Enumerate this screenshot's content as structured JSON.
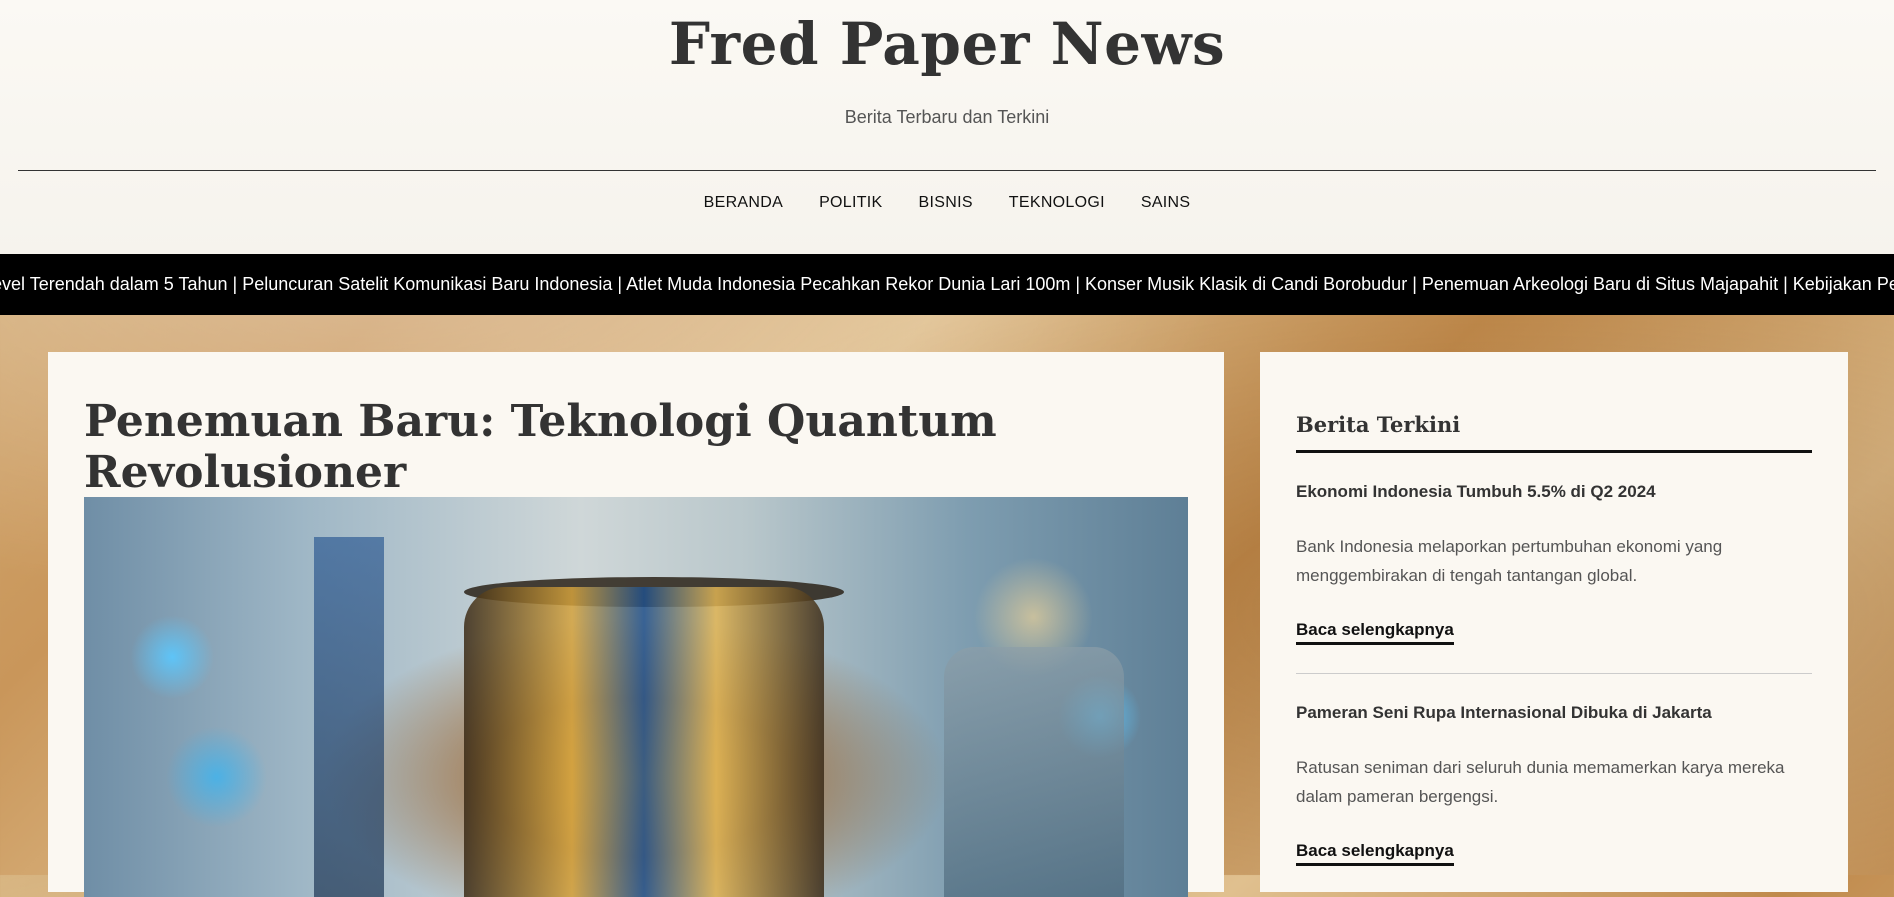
{
  "site": {
    "title": "Fred Paper News",
    "tagline": "Berita Terbaru dan Terkini"
  },
  "nav": {
    "items": [
      "BERANDA",
      "POLITIK",
      "BISNIS",
      "TEKNOLOGI",
      "SAINS"
    ]
  },
  "ticker": {
    "text": "evel Terendah dalam 5 Tahun | Peluncuran Satelit Komunikasi Baru Indonesia | Atlet Muda Indonesia Pecahkan Rekor Dunia Lari 100m | Konser Musik Klasik di Candi Borobudur | Penemuan Arkeologi Baru di Situs Majapahit | Kebijakan Pendidikan Baru: Ku"
  },
  "article": {
    "title": "Penemuan Baru: Teknologi Quantum Revolusioner"
  },
  "sidebar": {
    "title": "Berita Terkini",
    "items": [
      {
        "headline": "Ekonomi Indonesia Tumbuh 5.5% di Q2 2024",
        "summary": "Bank Indonesia melaporkan pertumbuhan ekonomi yang menggembirakan di tengah tantangan global.",
        "link": "Baca selengkapnya"
      },
      {
        "headline": "Pameran Seni Rupa Internasional Dibuka di Jakarta",
        "summary": "Ratusan seniman dari seluruh dunia memamerkan karya mereka dalam pameran bergengsi.",
        "link": "Baca selengkapnya"
      }
    ]
  }
}
